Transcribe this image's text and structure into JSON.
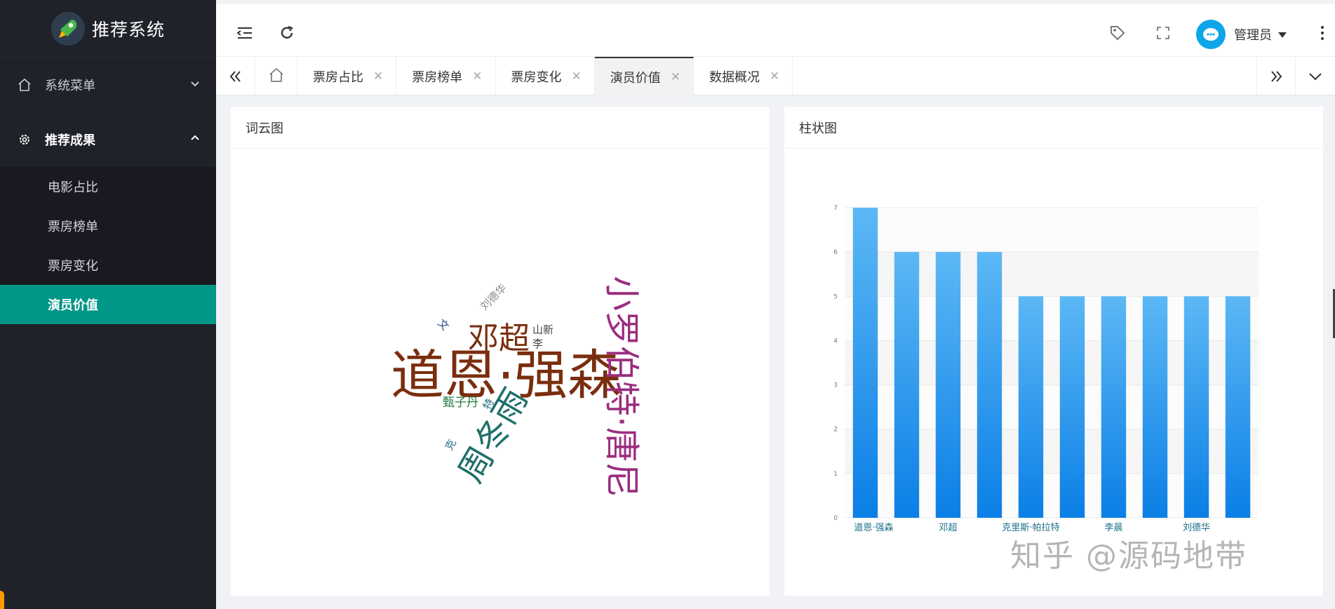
{
  "app": {
    "title": "推荐系统"
  },
  "sidebar": {
    "groups": [
      {
        "label": "系统菜单",
        "icon": "home-icon",
        "expanded": false
      },
      {
        "label": "推荐成果",
        "icon": "gear-icon",
        "expanded": true
      }
    ],
    "sub_items": [
      {
        "label": "电影占比",
        "selected": false
      },
      {
        "label": "票房榜单",
        "selected": false
      },
      {
        "label": "票房变化",
        "selected": false
      },
      {
        "label": "演员价值",
        "selected": true
      }
    ]
  },
  "header": {
    "user_name": "管理员",
    "icons": [
      "menu-fold-icon",
      "refresh-icon",
      "tag-icon",
      "fullscreen-icon",
      "more-icon"
    ]
  },
  "tabs": [
    {
      "label": "票房占比",
      "active": false
    },
    {
      "label": "票房榜单",
      "active": false
    },
    {
      "label": "票房变化",
      "active": false
    },
    {
      "label": "演员价值",
      "active": true
    },
    {
      "label": "数据概况",
      "active": false
    }
  ],
  "cards": {
    "wordcloud_title": "词云图",
    "bar_title": "柱状图"
  },
  "wordcloud": {
    "words": [
      {
        "text": "道恩·强森",
        "color": "#7a2e0e"
      },
      {
        "text": "小罗伯特·唐尼",
        "color": "#9b2d7f"
      },
      {
        "text": "周冬雨",
        "color": "#1f6f6a"
      },
      {
        "text": "邓超",
        "color": "#7a2e0e"
      },
      {
        "text": "刘德华",
        "color": "#8a8a8a"
      },
      {
        "text": "甄子丹",
        "color": "#1f7a3a"
      },
      {
        "text": "山新",
        "color": "#444"
      },
      {
        "text": "文",
        "color": "#2a4f8a"
      },
      {
        "text": "克",
        "color": "#2a6f8a"
      },
      {
        "text": "特",
        "color": "#2a6f8a"
      },
      {
        "text": "李",
        "color": "#444"
      }
    ]
  },
  "chart_data": {
    "type": "bar",
    "categories": [
      "道恩·强森",
      "",
      "邓超",
      "",
      "克里斯·帕拉特",
      "",
      "李晨",
      "",
      "刘德华",
      ""
    ],
    "values": [
      7,
      6,
      6,
      6,
      5,
      5,
      5,
      5,
      5,
      5
    ],
    "ylim": [
      0,
      7
    ],
    "yticks": [
      "0",
      "1",
      "2",
      "3",
      "4",
      "5",
      "6",
      "7"
    ],
    "bar_color_top": "#5cb8f5",
    "bar_color_bottom": "#0b7fe6",
    "grid": true,
    "legend": "none"
  },
  "watermark": "知乎 @源码地带"
}
